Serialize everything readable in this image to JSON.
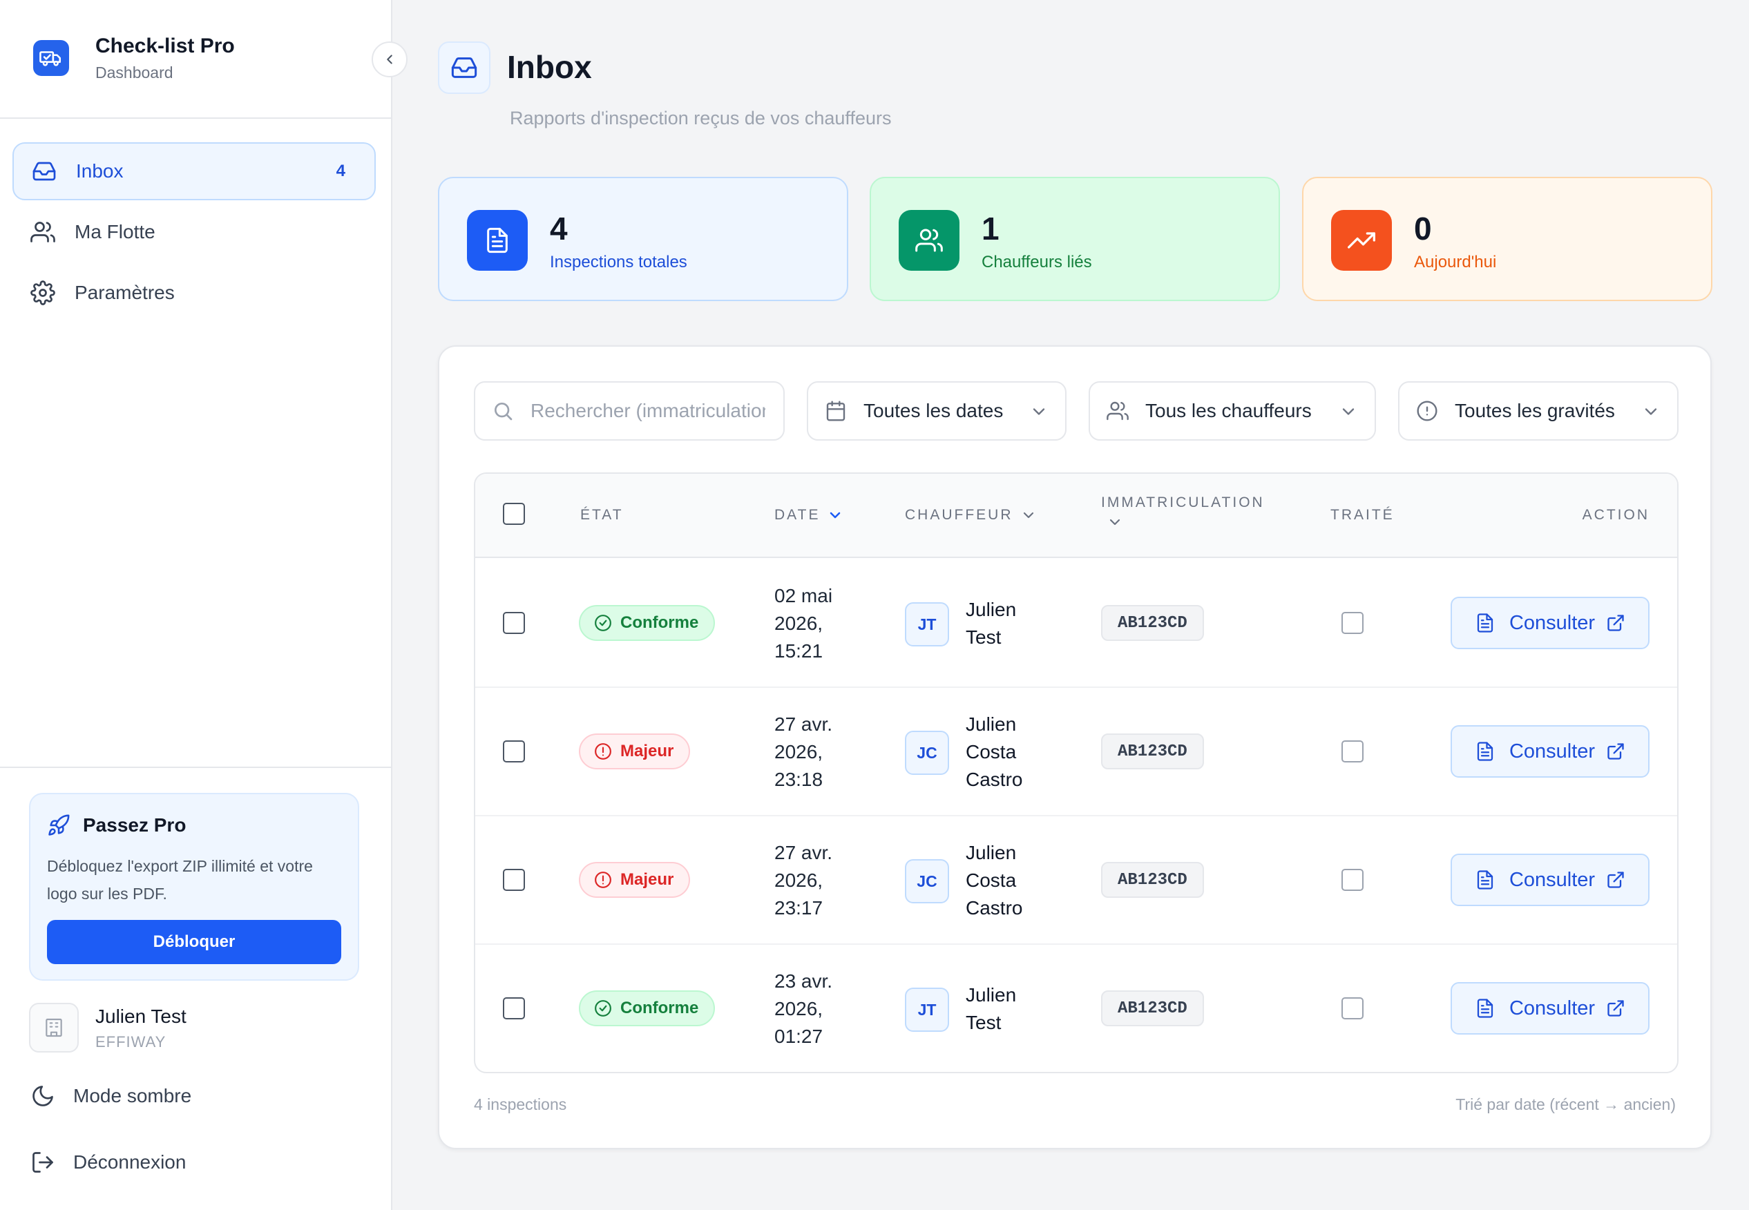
{
  "sidebar": {
    "app_name": "Check-list Pro",
    "app_sub": "Dashboard",
    "nav": [
      {
        "label": "Inbox",
        "icon": "inbox-icon",
        "badge": "4",
        "active": true
      },
      {
        "label": "Ma Flotte",
        "icon": "users-icon"
      },
      {
        "label": "Paramètres",
        "icon": "gear-icon"
      }
    ],
    "pro_card": {
      "title": "Passez Pro",
      "description": "Débloquez l'export ZIP illimité et votre logo sur les PDF.",
      "button": "Débloquer"
    },
    "user": {
      "name": "Julien Test",
      "org": "EFFIWAY"
    },
    "dark_mode": "Mode sombre",
    "logout": "Déconnexion"
  },
  "header": {
    "title": "Inbox",
    "subtitle": "Rapports d'inspection reçus de vos chauffeurs"
  },
  "stats": [
    {
      "value": "4",
      "label": "Inspections totales",
      "color": "#1d5cf5",
      "icon": "document-icon"
    },
    {
      "value": "1",
      "label": "Chauffeurs liés",
      "color": "#059669",
      "icon": "users-icon"
    },
    {
      "value": "0",
      "label": "Aujourd'hui",
      "color": "#f4511e",
      "icon": "trending-up-icon"
    }
  ],
  "filters": {
    "search_placeholder": "Rechercher (immatriculation...",
    "dates": "Toutes les dates",
    "drivers": "Tous les chauffeurs",
    "severities": "Toutes les gravités"
  },
  "table": {
    "columns": {
      "state": "ÉTAT",
      "date": "DATE",
      "driver": "CHAUFFEUR",
      "plate": "IMMATRICULATION",
      "treated": "TRAITÉ",
      "action": "ACTION"
    },
    "action_label": "Consulter",
    "rows": [
      {
        "state": "Conforme",
        "status": "ok",
        "date": [
          "02 mai",
          "2026,",
          "15:21"
        ],
        "initials": "JT",
        "driver": [
          "Julien",
          "Test"
        ],
        "plate": "AB123CD"
      },
      {
        "state": "Majeur",
        "status": "major",
        "date": [
          "27 avr.",
          "2026,",
          "23:18"
        ],
        "initials": "JC",
        "driver": [
          "Julien",
          "Costa",
          "Castro"
        ],
        "plate": "AB123CD"
      },
      {
        "state": "Majeur",
        "status": "major",
        "date": [
          "27 avr.",
          "2026,",
          "23:17"
        ],
        "initials": "JC",
        "driver": [
          "Julien",
          "Costa",
          "Castro"
        ],
        "plate": "AB123CD"
      },
      {
        "state": "Conforme",
        "status": "ok",
        "date": [
          "23 avr.",
          "2026,",
          "01:27"
        ],
        "initials": "JT",
        "driver": [
          "Julien",
          "Test"
        ],
        "plate": "AB123CD"
      }
    ]
  },
  "footer": {
    "count": "4 inspections",
    "sort_note": "Trié par date (récent → ancien)"
  },
  "colors": {
    "accent": "#1d5cf5",
    "ok": "#15803d",
    "major": "#dc2626"
  }
}
